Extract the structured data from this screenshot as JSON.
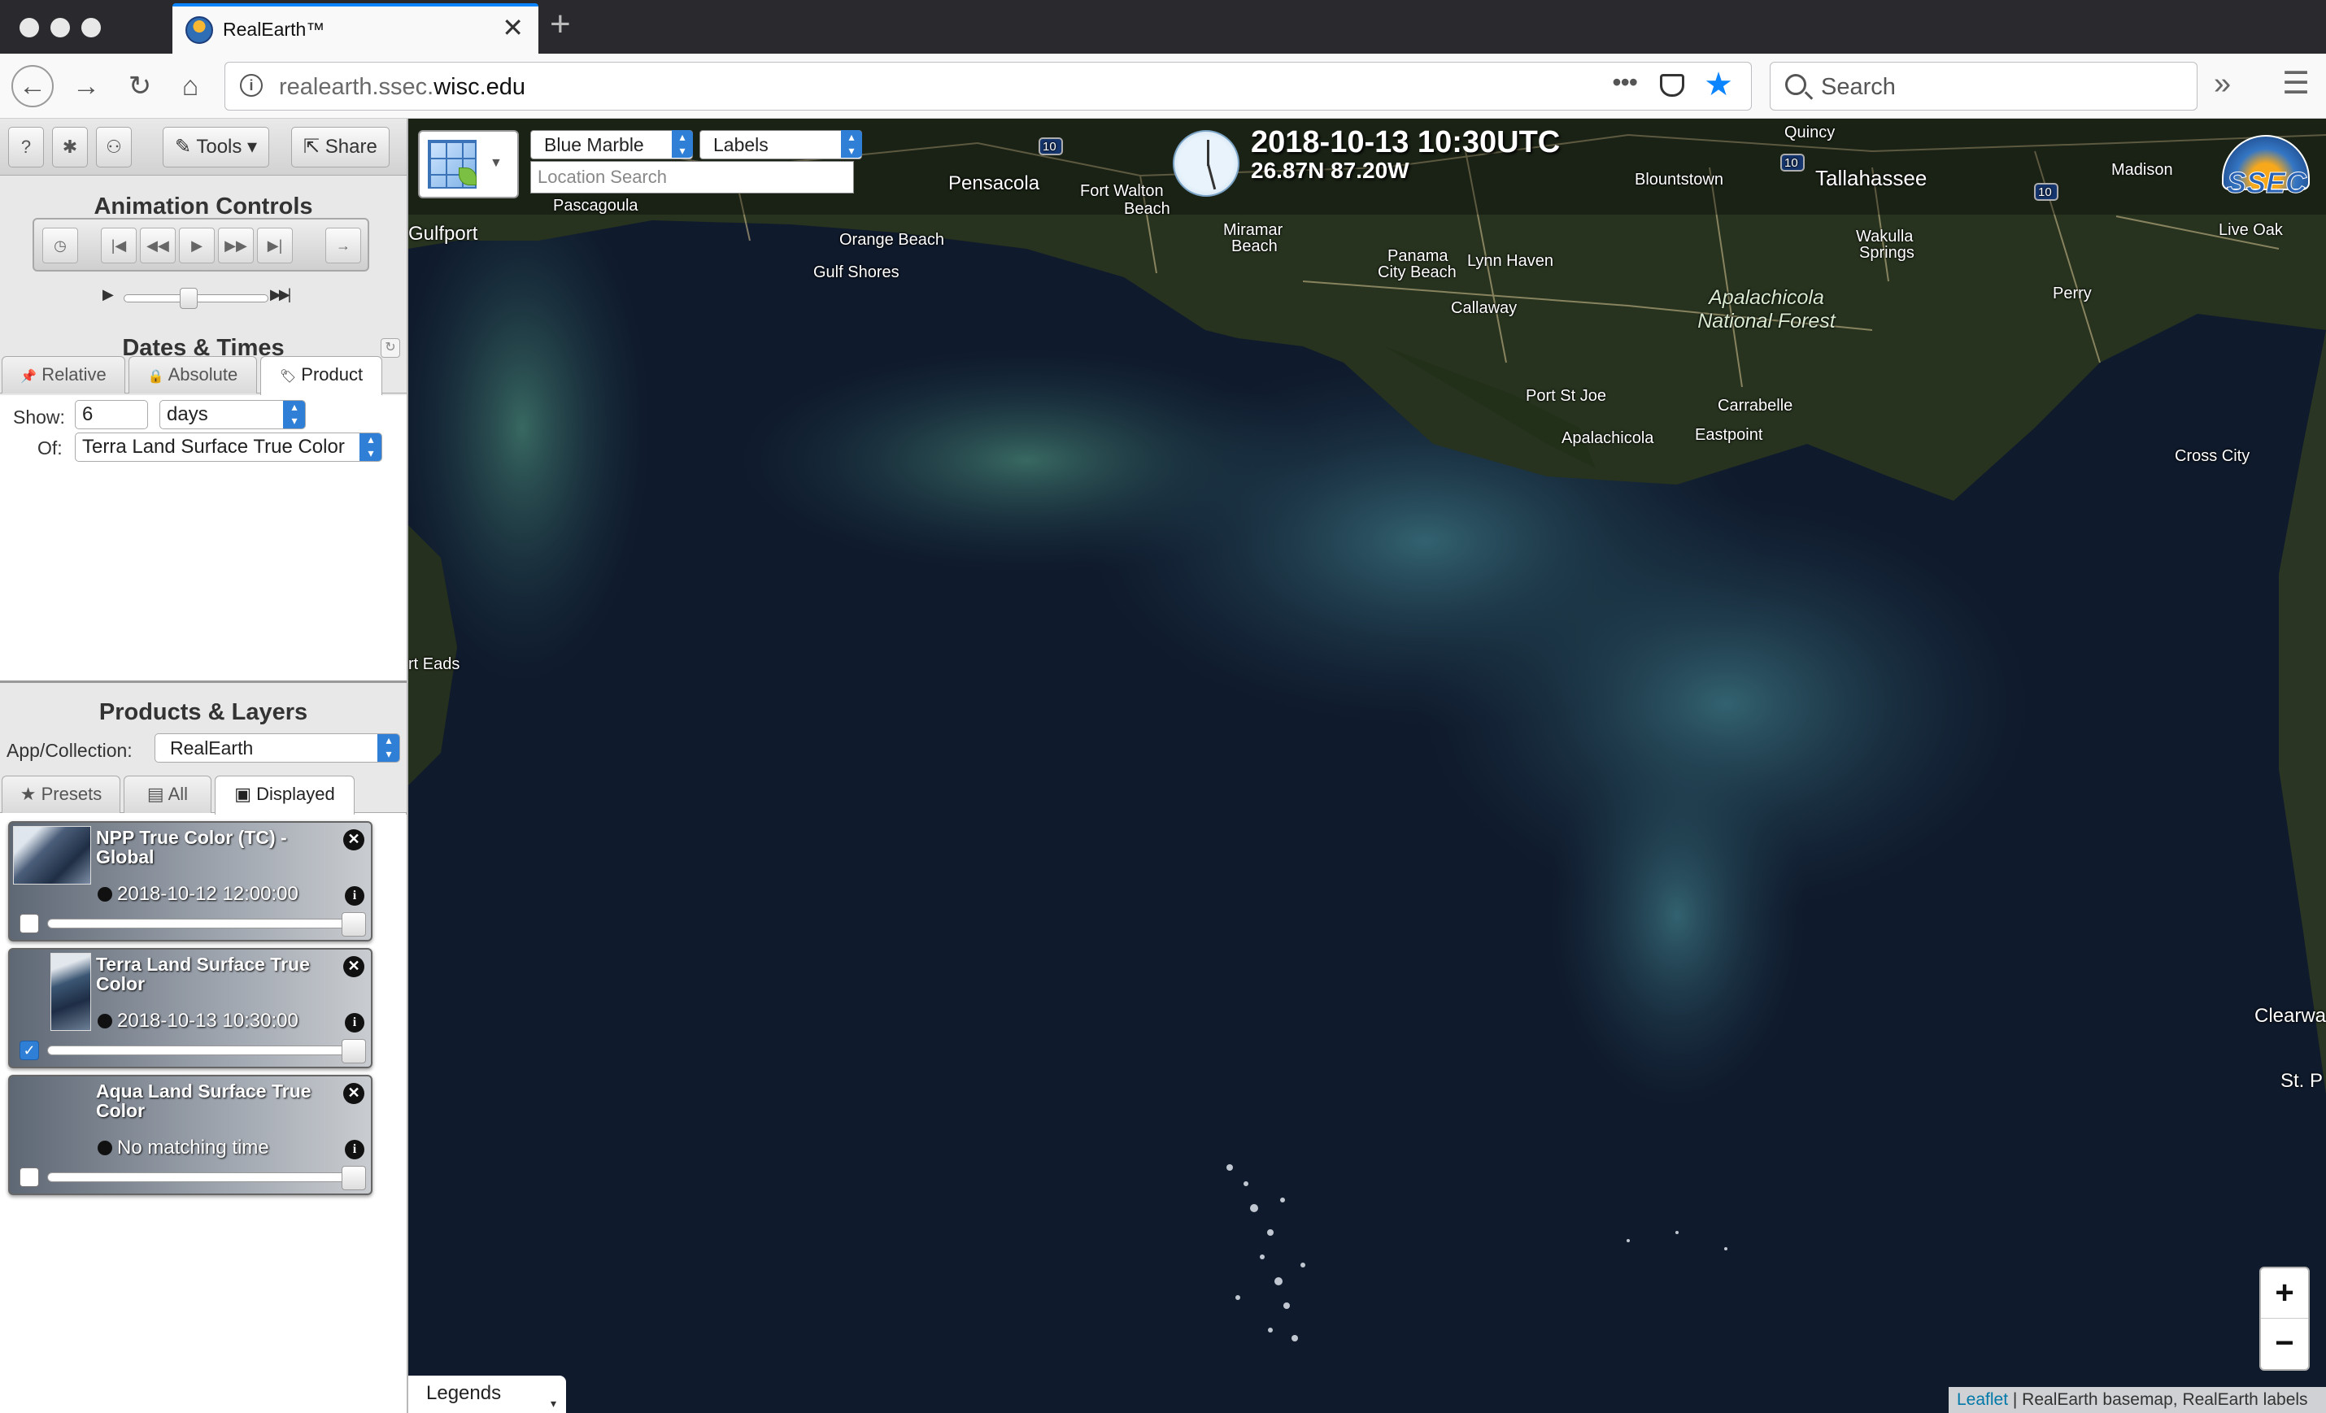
{
  "browser": {
    "tab_title": "RealEarth™",
    "tab_close": "✕",
    "new_tab": "+",
    "url_prefix": "realearth.ssec.",
    "url_host": "wisc.edu",
    "url_more": "•••",
    "search_placeholder": "Search",
    "overflow": "»",
    "menu": "☰",
    "back": "←",
    "forward": "→",
    "reload": "↻",
    "home": "⌂",
    "star_color": "#0a84ff"
  },
  "toolbar": {
    "help": "?",
    "settings": "✱",
    "user": "⚇",
    "tools_label": "✎ Tools ▾",
    "share_label": "⇱ Share"
  },
  "animation": {
    "title": "Animation Controls",
    "buttons": [
      "◷",
      "|◀",
      "◀◀",
      "▶",
      "▶▶",
      "▶|",
      "→"
    ],
    "play": "▶",
    "fast": "▶▶|",
    "speed_fraction": 0.45
  },
  "dates": {
    "title": "Dates & Times",
    "refresh": "↻",
    "tabs": [
      "Relative",
      "Absolute",
      "Product"
    ],
    "tab_icons": [
      "📌",
      "🔒",
      "🏷"
    ],
    "active_tab": "Product",
    "show_label": "Show:",
    "show_value": "6",
    "unit_value": "days",
    "of_label": "Of:",
    "of_value": "Terra Land Surface True Color"
  },
  "products": {
    "title": "Products & Layers",
    "app_label": "App/Collection:",
    "app_value": "RealEarth",
    "tabs": [
      "Presets",
      "All",
      "Displayed"
    ],
    "tab_icons": [
      "★",
      "▤",
      "▣"
    ],
    "active_tab": "Displayed",
    "layers": [
      {
        "title": "NPP True Color (TC) - Global",
        "time": "2018-10-12 12:00:00",
        "checked": false,
        "check_mark": ""
      },
      {
        "title": "Terra Land Surface True Color",
        "time": "2018-10-13 10:30:00",
        "checked": true,
        "check_mark": "✓"
      },
      {
        "title": "Aqua Land Surface True Color",
        "time": "No matching time",
        "checked": false,
        "check_mark": ""
      }
    ],
    "close_glyph": "✕",
    "info_glyph": "i"
  },
  "map": {
    "basemap_select": "Blue Marble",
    "labels_select": "Labels",
    "location_placeholder": "Location Search",
    "datetime": "2018-10-13 10:30UTC",
    "coords": "26.87N 87.20W",
    "logo_text": "SSEC",
    "zoom_in": "+",
    "zoom_out": "−",
    "legends_label": "Legends",
    "legends_caret": "▾",
    "attribution_link": "Leaflet",
    "attribution_text": " | RealEarth basemap, RealEarth labels",
    "ocean_color": "#0f1a2c",
    "land_color": "#27331f",
    "places": {
      "gulfport": "Gulfport",
      "pascagoula": "Pascagoula",
      "pensacola": "Pensacola",
      "fort_walton": "Fort Walton",
      "beach1": "Beach",
      "orange_beach": "Orange Beach",
      "gulf_shores": "Gulf Shores",
      "miramar": "Miramar",
      "beach2": "Beach",
      "panama_city": "Panama",
      "city_beach": "City Beach",
      "lynn_haven": "Lynn Haven",
      "callaway": "Callaway",
      "blountstown": "Blountstown",
      "quincy": "Quincy",
      "tallahassee": "Tallahassee",
      "madison": "Madison",
      "live_oak": "Live Oak",
      "wakulla": "Wakulla",
      "springs": "Springs",
      "perry": "Perry",
      "apalachicola_nf1": "Apalachicola",
      "apalachicola_nf2": "National Forest",
      "port_st_joe": "Port St Joe",
      "carrabelle": "Carrabelle",
      "apalachicola": "Apalachicola",
      "eastpoint": "Eastpoint",
      "cross_city": "Cross City",
      "port_eads": "rt Eads",
      "clearwater": "Clearwa",
      "st_p": "St. P",
      "i10a": "10",
      "i10b": "10",
      "i10c": "10"
    }
  }
}
